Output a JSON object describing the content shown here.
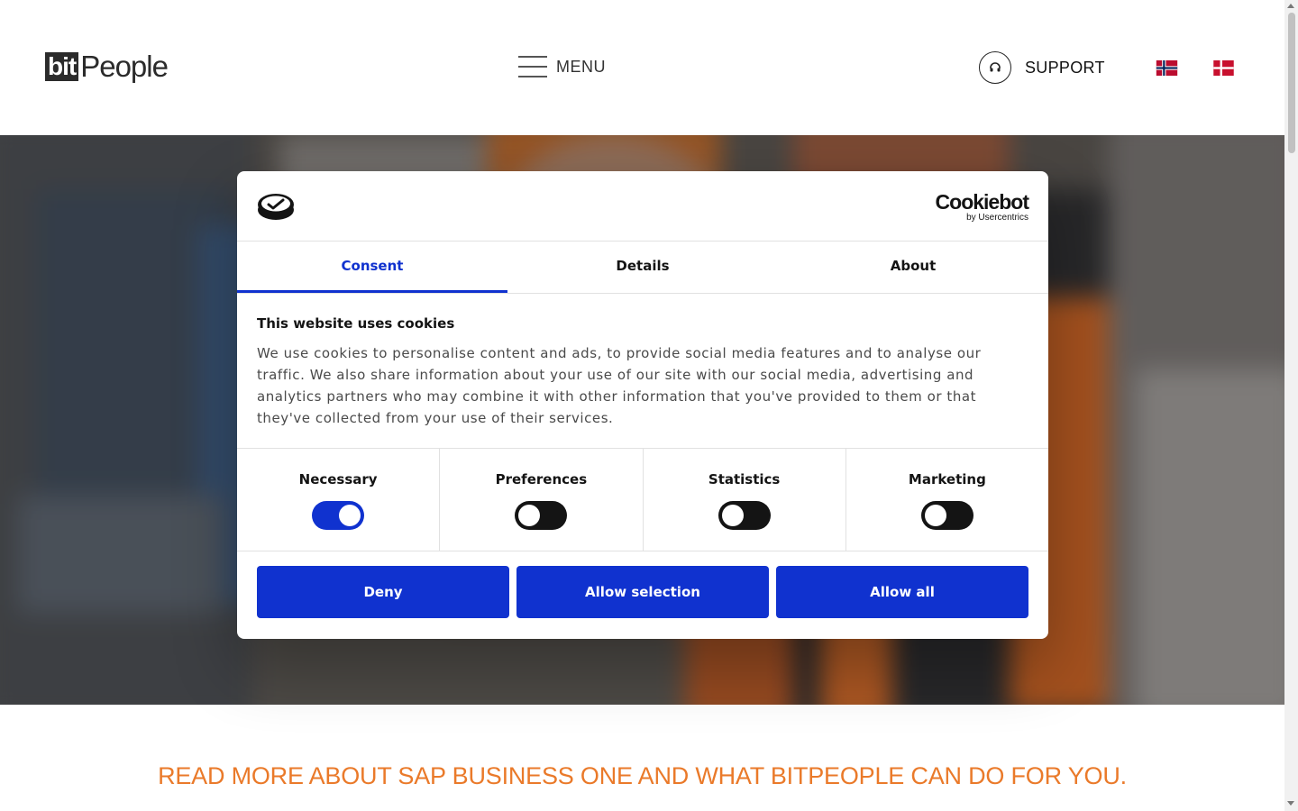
{
  "header": {
    "logo_bit": "bit",
    "logo_people": "People",
    "menu_label": "MENU",
    "support_label": "SUPPORT",
    "languages": [
      {
        "code": "no",
        "icon": "norway-flag-icon"
      },
      {
        "code": "dk",
        "icon": "denmark-flag-icon"
      }
    ]
  },
  "colors": {
    "accent_blue": "#1032cf",
    "headline_orange": "#ea7a2a",
    "text_dark": "#141414"
  },
  "cookie_dialog": {
    "brand_name": "Cookiebot",
    "brand_sub": "by Usercentrics",
    "tabs": [
      {
        "label": "Consent",
        "active": true
      },
      {
        "label": "Details",
        "active": false
      },
      {
        "label": "About",
        "active": false
      }
    ],
    "title": "This website uses cookies",
    "text": "We use cookies to personalise content and ads, to provide social media features and to analyse our traffic. We also share information about your use of our site with our social media, advertising and analytics partners who may combine it with other information that you've provided to them or that they've collected from your use of their services.",
    "categories": [
      {
        "label": "Necessary",
        "enabled": true
      },
      {
        "label": "Preferences",
        "enabled": false
      },
      {
        "label": "Statistics",
        "enabled": false
      },
      {
        "label": "Marketing",
        "enabled": false
      }
    ],
    "buttons": {
      "deny": "Deny",
      "allow_selection": "Allow selection",
      "allow_all": "Allow all"
    }
  },
  "headline": "READ MORE ABOUT SAP BUSINESS ONE AND WHAT BITPEOPLE CAN DO FOR YOU."
}
